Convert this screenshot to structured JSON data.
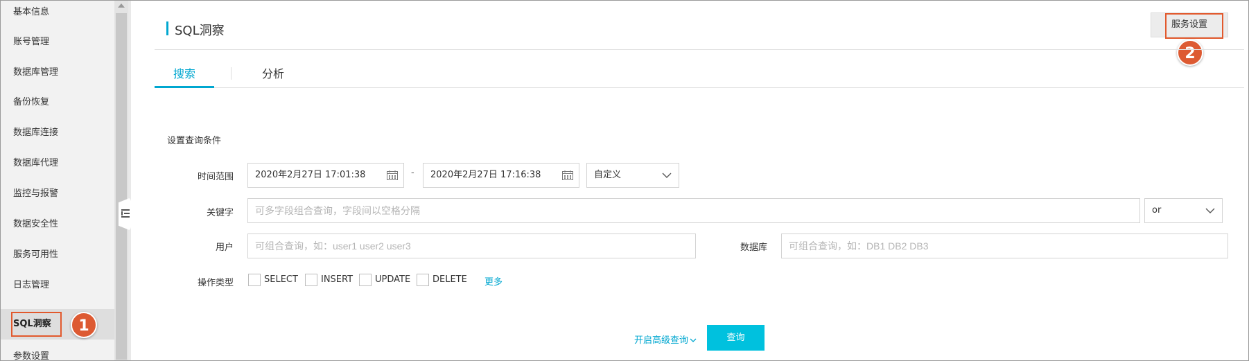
{
  "sidebar": {
    "items": [
      {
        "label": "基本信息"
      },
      {
        "label": "账号管理"
      },
      {
        "label": "数据库管理"
      },
      {
        "label": "备份恢复"
      },
      {
        "label": "数据库连接"
      },
      {
        "label": "数据库代理"
      },
      {
        "label": "监控与报警"
      },
      {
        "label": "数据安全性"
      },
      {
        "label": "服务可用性"
      },
      {
        "label": "日志管理"
      },
      {
        "label": "SQL洞察"
      },
      {
        "label": "参数设置"
      }
    ],
    "active_index": 10
  },
  "badges": {
    "first": "1",
    "second": "2"
  },
  "header": {
    "title": "SQL洞察",
    "service_settings_label": "服务设置"
  },
  "tabs": [
    {
      "label": "搜索"
    },
    {
      "label": "分析"
    }
  ],
  "form": {
    "section_title": "设置查询条件",
    "time_range": {
      "label": "时间范围",
      "start": "2020年2月27日 17:01:38",
      "separator": "-",
      "end": "2020年2月27日 17:16:38",
      "preset": "自定义"
    },
    "keyword": {
      "label": "关键字",
      "placeholder": "可多字段组合查询，字段间以空格分隔",
      "operator": "or"
    },
    "user": {
      "label": "用户",
      "placeholder": "可组合查询，如：user1 user2 user3"
    },
    "database": {
      "label": "数据库",
      "placeholder": "可组合查询，如：DB1 DB2 DB3"
    },
    "operation_type": {
      "label": "操作类型",
      "options": [
        "SELECT",
        "INSERT",
        "UPDATE",
        "DELETE"
      ],
      "more_label": "更多"
    },
    "advanced_query_label": "开启高级查询",
    "query_button_label": "查询"
  },
  "colors": {
    "accent": "#00a7d0",
    "primary_button": "#00c1de",
    "highlight": "#e2592d"
  }
}
